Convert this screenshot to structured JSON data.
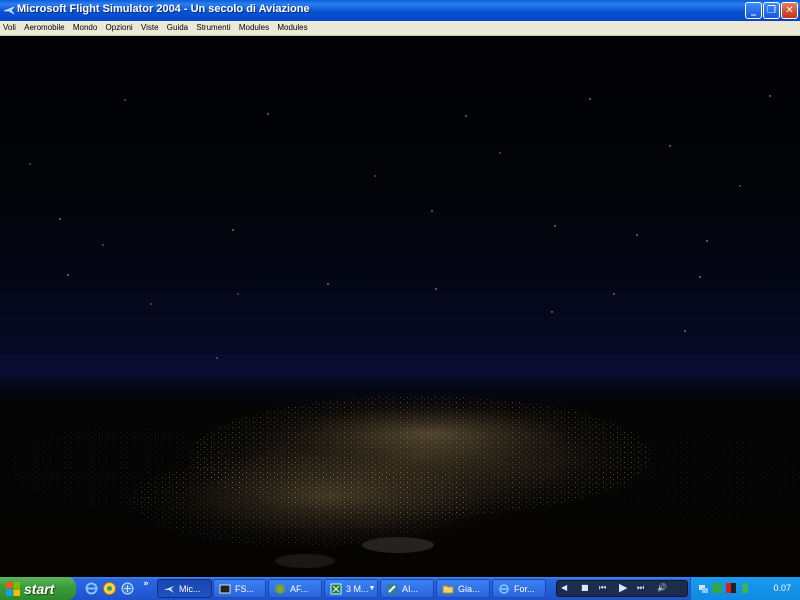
{
  "window": {
    "title": "Microsoft Flight Simulator 2004 - Un secolo di Aviazione",
    "controls": {
      "minimize": "_",
      "restore": "❐",
      "close": "✕"
    }
  },
  "menu": [
    "Voli",
    "Aeromobile",
    "Mondo",
    "Opzioni",
    "Viste",
    "Guida",
    "Strumenti",
    "Modules",
    "Modules"
  ],
  "taskbar": {
    "start_label": "start",
    "quick_launch": [
      "internet-explorer-icon",
      "messenger-icon",
      "browser-icon"
    ],
    "overflow": "»",
    "tasks": [
      {
        "label": "Mic...",
        "icon": "flight-sim-icon",
        "active": true
      },
      {
        "label": "FS...",
        "icon": "terminal-icon",
        "active": false
      },
      {
        "label": "AF...",
        "icon": "app-icon",
        "active": false
      },
      {
        "label": "3 M...",
        "icon": "excel-icon",
        "active": false,
        "grouped": true
      },
      {
        "label": "AI...",
        "icon": "tool-icon",
        "active": false
      },
      {
        "label": "Gia...",
        "icon": "folder-icon",
        "active": false
      },
      {
        "label": "For...",
        "icon": "internet-explorer-icon",
        "active": false
      }
    ],
    "media_player": [
      "◀",
      "■",
      "⏮",
      "▶",
      "⏭",
      "🔊"
    ],
    "clock": "0.07"
  },
  "colors": {
    "titlebar": "#0753d4",
    "menubar": "#ece9d8",
    "taskbar": "#245edb",
    "start": "#3c9e3b",
    "tray": "#0f8ae0"
  }
}
